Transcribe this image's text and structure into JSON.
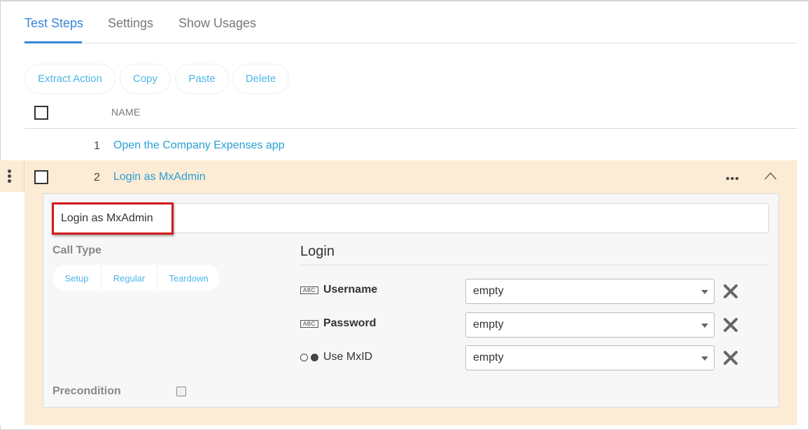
{
  "tabs": [
    {
      "label": "Test Steps"
    },
    {
      "label": "Settings"
    },
    {
      "label": "Show Usages"
    }
  ],
  "toolbar": {
    "extract_action": "Extract Action",
    "copy": "Copy",
    "paste": "Paste",
    "delete": "Delete"
  },
  "table": {
    "column_name": "NAME",
    "rows": [
      {
        "number": "1",
        "name": "Open the Company Expenses app"
      },
      {
        "number": "2",
        "name": "Login as MxAdmin"
      }
    ]
  },
  "details": {
    "step_name_value": "Login as MxAdmin",
    "call_type_label": "Call Type",
    "call_type_options": [
      "Setup",
      "Regular",
      "Teardown"
    ],
    "section_title": "Login",
    "parameters": [
      {
        "type_badge": "ABC",
        "label": "Username",
        "value": "empty"
      },
      {
        "type_badge": "ABC",
        "label": "Password",
        "value": "empty"
      },
      {
        "type_badge": "",
        "label": "Use MxID",
        "value": "empty"
      }
    ],
    "precondition_label": "Precondition"
  },
  "colors": {
    "accent": "#3a86d8",
    "link": "#2a9fd6",
    "selected_row_bg": "#fcebd5",
    "highlight_border": "#d21a1a"
  }
}
